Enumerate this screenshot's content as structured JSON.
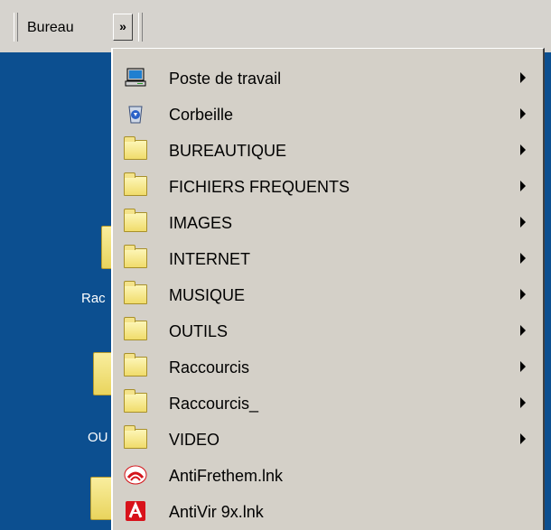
{
  "taskbar": {
    "toolbar_label": "Bureau",
    "chevron_label": "»"
  },
  "desktop": {
    "labels": [
      "Rac",
      "OU"
    ]
  },
  "menu": {
    "items": [
      {
        "label": "Poste de travail",
        "icon": "my-computer-icon",
        "submenu": true
      },
      {
        "label": "Corbeille",
        "icon": "recycle-bin-icon",
        "submenu": true
      },
      {
        "label": "BUREAUTIQUE",
        "icon": "folder-icon",
        "submenu": true
      },
      {
        "label": "FICHIERS FREQUENTS",
        "icon": "folder-icon",
        "submenu": true
      },
      {
        "label": "IMAGES",
        "icon": "folder-icon",
        "submenu": true
      },
      {
        "label": "INTERNET",
        "icon": "folder-icon",
        "submenu": true
      },
      {
        "label": "MUSIQUE",
        "icon": "folder-icon",
        "submenu": true
      },
      {
        "label": "OUTILS",
        "icon": "folder-icon",
        "submenu": true
      },
      {
        "label": "Raccourcis",
        "icon": "folder-icon",
        "submenu": true
      },
      {
        "label": "Raccourcis_",
        "icon": "folder-icon",
        "submenu": true
      },
      {
        "label": "VIDEO",
        "icon": "folder-icon",
        "submenu": true
      },
      {
        "label": "AntiFrethem.lnk",
        "icon": "antifrethem-icon",
        "submenu": false
      },
      {
        "label": "AntiVir 9x.lnk",
        "icon": "antivir-icon",
        "submenu": false
      }
    ]
  }
}
